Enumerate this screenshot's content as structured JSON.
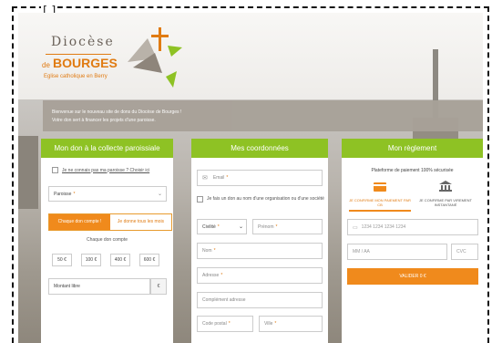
{
  "frame": {
    "corner_text": "[ ]"
  },
  "logo": {
    "diocese": "Diocèse",
    "de": "de",
    "bourges": "BOURGES",
    "subtitle": "Eglise catholique en Berry",
    "colors": {
      "orange": "#e07b12",
      "green": "#8ec224",
      "brown": "#6b625a"
    }
  },
  "banner": {
    "line1": "Bienvenue sur le nouveau site de dons du Diocèse de Bourges !",
    "line2": "Votre don sert à financer les projets d'une paroisse."
  },
  "panel_donation": {
    "title": "Mon don à la collecte paroissiale",
    "unknown_parish": "Je ne connais pas ma paroisse ? Choisir ici",
    "parish_placeholder": "Paroisse",
    "parish_req": "*",
    "toggle_left": "Chaque don compte !",
    "toggle_right": "Je donne tous les mois",
    "caption": "Chaque don compte",
    "amounts": [
      "50 €",
      "100 €",
      "400 €",
      "600 €"
    ],
    "free_amount": "Montant libre",
    "currency": "€"
  },
  "panel_contact": {
    "title": "Mes coordonnées",
    "email": "Email",
    "org_check": "Je fais un don au nom d'une organisation ou d'une société",
    "civility": "Civilité",
    "firstname": "Prénom",
    "lastname": "Nom",
    "address": "Adresse",
    "address_extra": "Complément adresse",
    "postal": "Code postal",
    "city": "Ville",
    "req": "*"
  },
  "panel_payment": {
    "title": "Mon règlement",
    "platform": "Plateforme de paiement 100% sécurisée",
    "method_card": "JE CONFIRME MON PAIEMENT PAR CB",
    "method_transfer": "JE CONFIRME PAR VIREMENT INSTANTANÉ",
    "card_number": "1234 1234 1234 1234",
    "expiry": "MM / AA",
    "cvc": "CVC",
    "validate": "VALIDER 0 €"
  }
}
